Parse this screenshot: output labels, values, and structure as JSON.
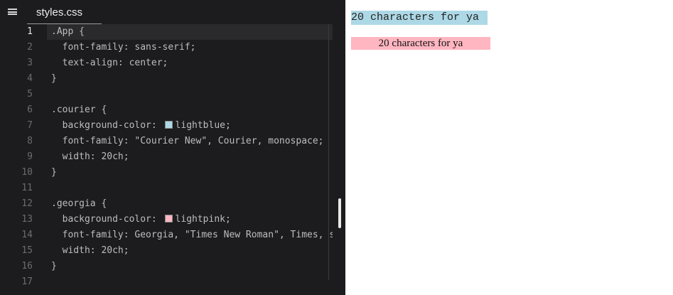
{
  "tab": {
    "filename": "styles.css"
  },
  "colors": {
    "lightblue": "#add8e6",
    "lightpink": "#ffb6c1"
  },
  "code_lines": [
    {
      "n": "1",
      "text": ".App {",
      "active": true
    },
    {
      "n": "2",
      "text": "  font-family: sans-serif;"
    },
    {
      "n": "3",
      "text": "  text-align: center;"
    },
    {
      "n": "4",
      "text": "}"
    },
    {
      "n": "5",
      "text": ""
    },
    {
      "n": "6",
      "text": ".courier {"
    },
    {
      "n": "7",
      "pre": "  background-color: ",
      "swatch": "#add8e6",
      "post": "lightblue;"
    },
    {
      "n": "8",
      "text": "  font-family: \"Courier New\", Courier, monospace;"
    },
    {
      "n": "9",
      "text": "  width: 20ch;"
    },
    {
      "n": "10",
      "text": "}"
    },
    {
      "n": "11",
      "text": ""
    },
    {
      "n": "12",
      "text": ".georgia {"
    },
    {
      "n": "13",
      "pre": "  background-color: ",
      "swatch": "#ffb6c1",
      "post": "lightpink;"
    },
    {
      "n": "14",
      "text": "  font-family: Georgia, \"Times New Roman\", Times, serif;"
    },
    {
      "n": "15",
      "text": "  width: 20ch;"
    },
    {
      "n": "16",
      "text": "}"
    },
    {
      "n": "17",
      "text": ""
    }
  ],
  "preview": {
    "courier_text": "20 characters for ya",
    "georgia_text": "20 characters for ya"
  }
}
